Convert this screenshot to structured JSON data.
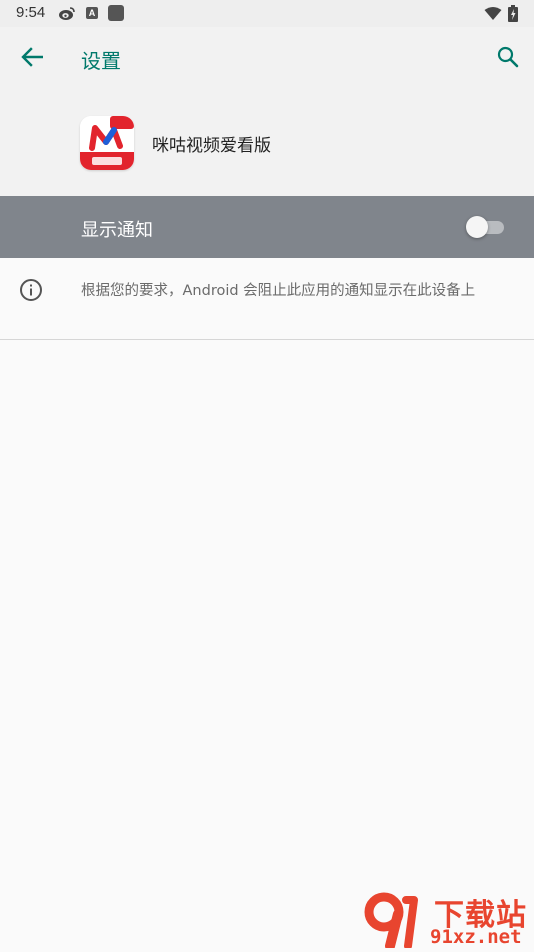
{
  "status_bar": {
    "time": "9:54",
    "a_badge": "A"
  },
  "app_bar": {
    "title": "设置"
  },
  "app": {
    "name": "咪咕视频爱看版"
  },
  "notification_setting": {
    "label": "显示通知",
    "enabled": false
  },
  "info": {
    "text": "根据您的要求，Android 会阻止此应用的通知显示在此设备上"
  },
  "watermark": {
    "top": "下载站",
    "bottom": "91xz.net"
  },
  "colors": {
    "accent": "#00796b",
    "toggle_row_bg": "#80858c",
    "watermark": "#e8452f"
  }
}
